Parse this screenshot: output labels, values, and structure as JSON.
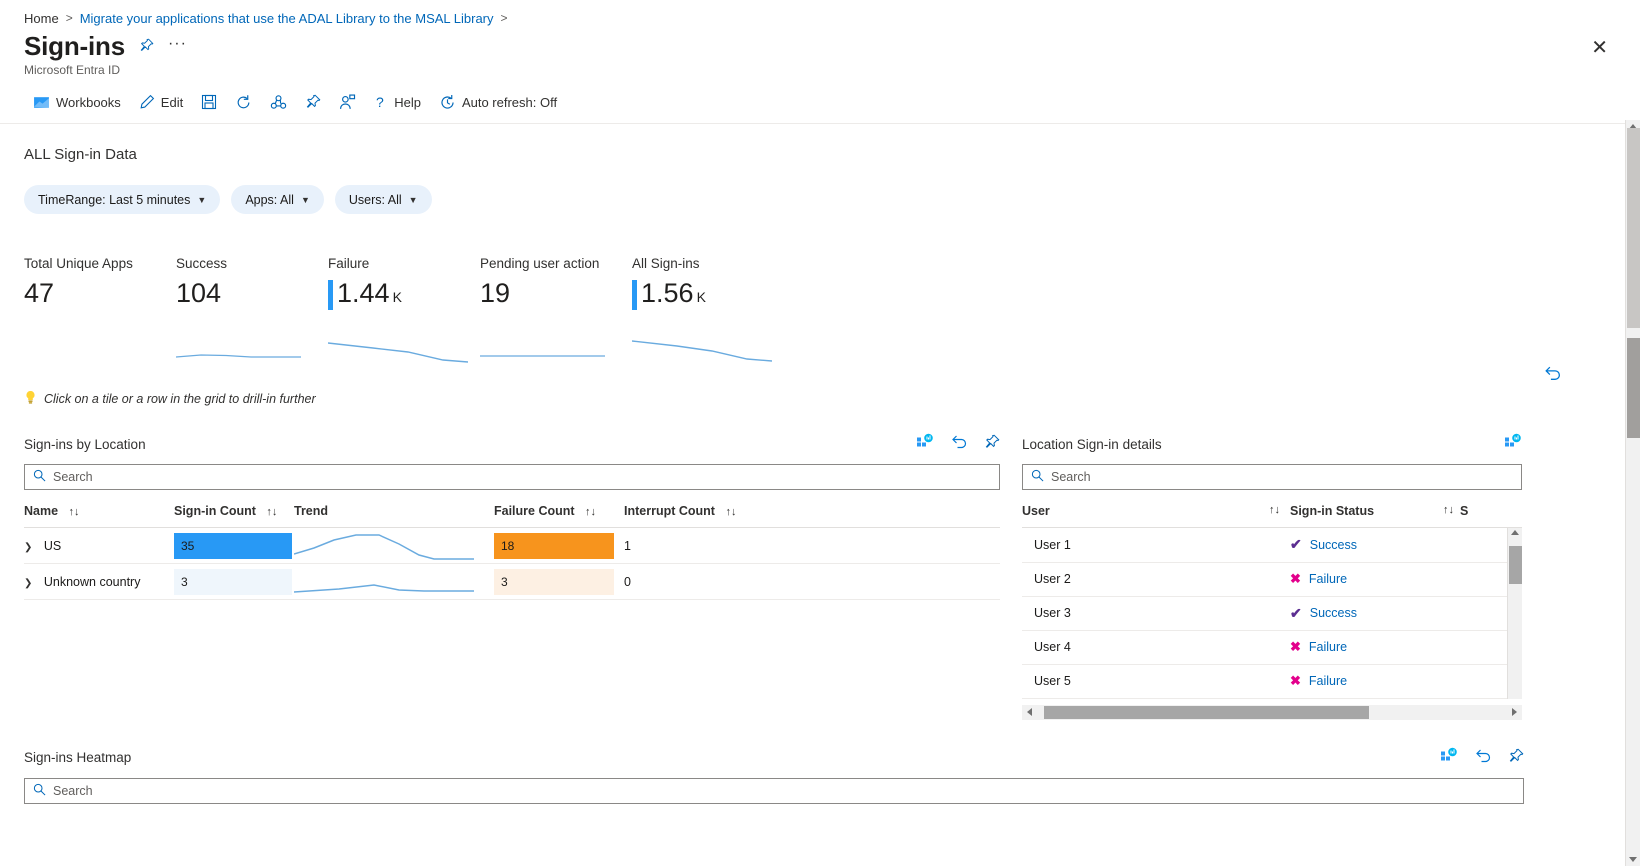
{
  "breadcrumb": {
    "home": "Home",
    "link": "Migrate your applications that use the ADAL Library to the MSAL Library",
    "separator": ">"
  },
  "header": {
    "title": "Sign-ins",
    "subtitle": "Microsoft Entra ID",
    "pin_icon": "pin-icon",
    "more_label": "···",
    "close_label": "✕"
  },
  "commandbar": {
    "items": [
      {
        "label": "Workbooks",
        "icon": "workbooks-icon"
      },
      {
        "label": "Edit",
        "icon": "pencil-icon"
      },
      {
        "label": "",
        "icon": "save-icon"
      },
      {
        "label": "",
        "icon": "refresh-icon"
      },
      {
        "label": "",
        "icon": "share-icon"
      },
      {
        "label": "",
        "icon": "pin-icon"
      },
      {
        "label": "",
        "icon": "add-user-icon"
      },
      {
        "label": "Help",
        "icon": "question-icon"
      },
      {
        "label": "Auto refresh: Off",
        "icon": "clock-icon"
      }
    ]
  },
  "main": {
    "section_title": "ALL Sign-in Data",
    "filters": [
      {
        "label": "TimeRange: Last 5 minutes",
        "name": "timerange-filter"
      },
      {
        "label": "Apps: All",
        "name": "apps-filter"
      },
      {
        "label": "Users: All",
        "name": "users-filter"
      }
    ],
    "hint": "Click on a tile or a row in the grid to drill-in further",
    "hint_icon": "lightbulb-icon",
    "revert_icon": "revert-icon"
  },
  "tiles": [
    {
      "label": "Total Unique Apps",
      "value": "47",
      "unit": "",
      "has_bar": false,
      "has_spark": false
    },
    {
      "label": "Success",
      "value": "104",
      "unit": "",
      "has_bar": false,
      "has_spark": true
    },
    {
      "label": "Failure",
      "value": "1.44",
      "unit": "K",
      "has_bar": true,
      "has_spark": true
    },
    {
      "label": "Pending user action",
      "value": "19",
      "unit": "",
      "has_bar": false,
      "has_spark": true
    },
    {
      "label": "All Sign-ins",
      "value": "1.56",
      "unit": "K",
      "has_bar": true,
      "has_spark": true
    }
  ],
  "locations_panel": {
    "title": "Sign-ins by Location",
    "search_placeholder": "Search",
    "actions": [
      "chart-icon",
      "revert-icon",
      "pin-icon"
    ],
    "columns": [
      "Name",
      "Sign-in Count",
      "Trend",
      "Failure Count",
      "Interrupt Count"
    ],
    "rows": [
      {
        "name": "US",
        "signin_count": "35",
        "failure_count": "18",
        "interrupt_count": "1"
      },
      {
        "name": "Unknown country",
        "signin_count": "3",
        "failure_count": "3",
        "interrupt_count": "0"
      }
    ]
  },
  "details_panel": {
    "title": "Location Sign-in details",
    "search_placeholder": "Search",
    "actions": [
      "chart-icon"
    ],
    "columns": [
      "User",
      "Sign-in Status",
      "S"
    ],
    "rows": [
      {
        "user": "User 1",
        "status": "Success",
        "status_icon": "check-icon"
      },
      {
        "user": "User 2",
        "status": "Failure",
        "status_icon": "cross-icon"
      },
      {
        "user": "User 3",
        "status": "Success",
        "status_icon": "check-icon"
      },
      {
        "user": "User 4",
        "status": "Failure",
        "status_icon": "cross-icon"
      },
      {
        "user": "User 5",
        "status": "Failure",
        "status_icon": "cross-icon"
      }
    ]
  },
  "heatmap_panel": {
    "title": "Sign-ins Heatmap",
    "search_placeholder": "Search",
    "actions": [
      "chart-icon",
      "revert-icon",
      "pin-icon"
    ]
  },
  "colors": {
    "accent": "#0067b8",
    "bar_blue": "#2899f5",
    "bar_blue_light": "#eff6fc",
    "bar_orange": "#f7941d",
    "bar_orange_light": "#fdf0e3",
    "success": "#5c2e91",
    "failure": "#e3008c",
    "spark_line": "#6aabdf"
  }
}
